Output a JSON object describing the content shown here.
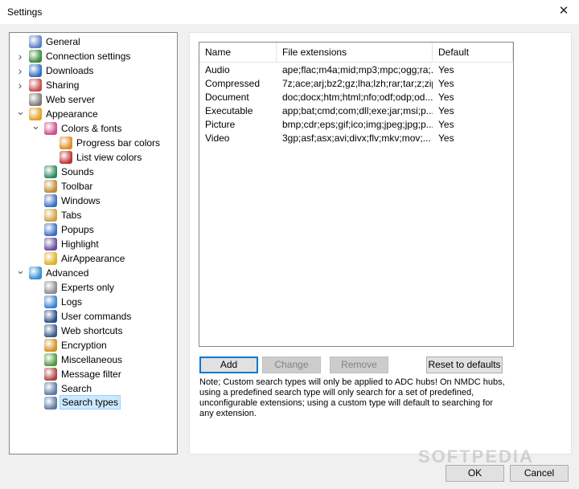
{
  "window": {
    "title": "Settings",
    "close_glyph": "✕"
  },
  "tree": [
    {
      "label": "General",
      "icon": "user-icon",
      "color": "#5b7fc4",
      "has_arrow": false,
      "expanded": false,
      "level": 0,
      "selected": false
    },
    {
      "label": "Connection settings",
      "icon": "gauge-icon",
      "color": "#3a8a3a",
      "has_arrow": true,
      "expanded": false,
      "level": 0,
      "selected": false
    },
    {
      "label": "Downloads",
      "icon": "globe-download-icon",
      "color": "#2f6fbf",
      "has_arrow": true,
      "expanded": false,
      "level": 0,
      "selected": false
    },
    {
      "label": "Sharing",
      "icon": "sharing-icon",
      "color": "#c94a4a",
      "has_arrow": true,
      "expanded": false,
      "level": 0,
      "selected": false
    },
    {
      "label": "Web server",
      "icon": "web-server-icon",
      "color": "#7a7a7a",
      "has_arrow": false,
      "expanded": false,
      "level": 0,
      "selected": false
    },
    {
      "label": "Appearance",
      "icon": "palette-icon",
      "color": "#e0a020",
      "has_arrow": true,
      "expanded": true,
      "level": 0,
      "selected": false
    },
    {
      "label": "Colors & fonts",
      "icon": "colors-icon",
      "color": "#d04a8a",
      "has_arrow": true,
      "expanded": true,
      "level": 1,
      "selected": false
    },
    {
      "label": "Progress bar colors",
      "icon": "progress-colors-icon",
      "color": "#e08a20",
      "has_arrow": false,
      "expanded": false,
      "level": 2,
      "selected": false
    },
    {
      "label": "List view colors",
      "icon": "list-colors-icon",
      "color": "#c03030",
      "has_arrow": false,
      "expanded": false,
      "level": 2,
      "selected": false
    },
    {
      "label": "Sounds",
      "icon": "speaker-icon",
      "color": "#2a8a5a",
      "has_arrow": false,
      "expanded": false,
      "level": 1,
      "selected": false
    },
    {
      "label": "Toolbar",
      "icon": "toolbar-icon",
      "color": "#c08a30",
      "has_arrow": false,
      "expanded": false,
      "level": 1,
      "selected": false
    },
    {
      "label": "Windows",
      "icon": "window-icon",
      "color": "#3a6fc0",
      "has_arrow": false,
      "expanded": false,
      "level": 1,
      "selected": false
    },
    {
      "label": "Tabs",
      "icon": "tabs-icon",
      "color": "#d0a040",
      "has_arrow": false,
      "expanded": false,
      "level": 1,
      "selected": false
    },
    {
      "label": "Popups",
      "icon": "popup-icon",
      "color": "#3a6fc0",
      "has_arrow": false,
      "expanded": false,
      "level": 1,
      "selected": false
    },
    {
      "label": "Highlight",
      "icon": "highlight-icon",
      "color": "#6a4aa0",
      "has_arrow": false,
      "expanded": false,
      "level": 1,
      "selected": false
    },
    {
      "label": "AirAppearance",
      "icon": "air-appearance-icon",
      "color": "#e0b020",
      "has_arrow": false,
      "expanded": false,
      "level": 1,
      "selected": false
    },
    {
      "label": "Advanced",
      "icon": "advanced-gear-icon",
      "color": "#2f8fd0",
      "has_arrow": true,
      "expanded": true,
      "level": 0,
      "selected": false
    },
    {
      "label": "Experts only",
      "icon": "gears-icon",
      "color": "#8a8a8a",
      "has_arrow": false,
      "expanded": false,
      "level": 1,
      "selected": false
    },
    {
      "label": "Logs",
      "icon": "logs-icon",
      "color": "#3a7fd0",
      "has_arrow": false,
      "expanded": false,
      "level": 1,
      "selected": false
    },
    {
      "label": "User commands",
      "icon": "user-commands-icon",
      "color": "#2a4a8a",
      "has_arrow": false,
      "expanded": false,
      "level": 1,
      "selected": false
    },
    {
      "label": "Web shortcuts",
      "icon": "web-shortcuts-icon",
      "color": "#3a5a8a",
      "has_arrow": false,
      "expanded": false,
      "level": 1,
      "selected": false
    },
    {
      "label": "Encryption",
      "icon": "lock-icon",
      "color": "#d09020",
      "has_arrow": false,
      "expanded": false,
      "level": 1,
      "selected": false
    },
    {
      "label": "Miscellaneous",
      "icon": "pencil-icon",
      "color": "#4a9a3a",
      "has_arrow": false,
      "expanded": false,
      "level": 1,
      "selected": false
    },
    {
      "label": "Message filter",
      "icon": "message-filter-icon",
      "color": "#b04040",
      "has_arrow": false,
      "expanded": false,
      "level": 1,
      "selected": false
    },
    {
      "label": "Search",
      "icon": "search-icon",
      "color": "#5a7aa0",
      "has_arrow": false,
      "expanded": false,
      "level": 1,
      "selected": false
    },
    {
      "label": "Search types",
      "icon": "search-types-icon",
      "color": "#5a7aa0",
      "has_arrow": false,
      "expanded": false,
      "level": 1,
      "selected": true
    }
  ],
  "list": {
    "columns": [
      "Name",
      "File extensions",
      "Default"
    ],
    "rows": [
      [
        "Audio",
        "ape;flac;m4a;mid;mp3;mpc;ogg;ra;...",
        "Yes"
      ],
      [
        "Compressed",
        "7z;ace;arj;bz2;gz;lha;lzh;rar;tar;z;zip",
        "Yes"
      ],
      [
        "Document",
        "doc;docx;htm;html;nfo;odf;odp;od...",
        "Yes"
      ],
      [
        "Executable",
        "app;bat;cmd;com;dll;exe;jar;msi;p...",
        "Yes"
      ],
      [
        "Picture",
        "bmp;cdr;eps;gif;ico;img;jpeg;jpg;p...",
        "Yes"
      ],
      [
        "Video",
        "3gp;asf;asx;avi;divx;flv;mkv;mov;...",
        "Yes"
      ]
    ]
  },
  "buttons": {
    "add": "Add",
    "change": "Change",
    "remove": "Remove",
    "reset": "Reset to defaults",
    "ok": "OK",
    "cancel": "Cancel"
  },
  "note": "Note; Custom search types will only be applied to ADC hubs! On NMDC hubs, using a predefined search type will only search for a set of predefined, unconfigurable extensions; using a custom type will default to searching for any extension.",
  "watermark": "SOFTPEDIA"
}
